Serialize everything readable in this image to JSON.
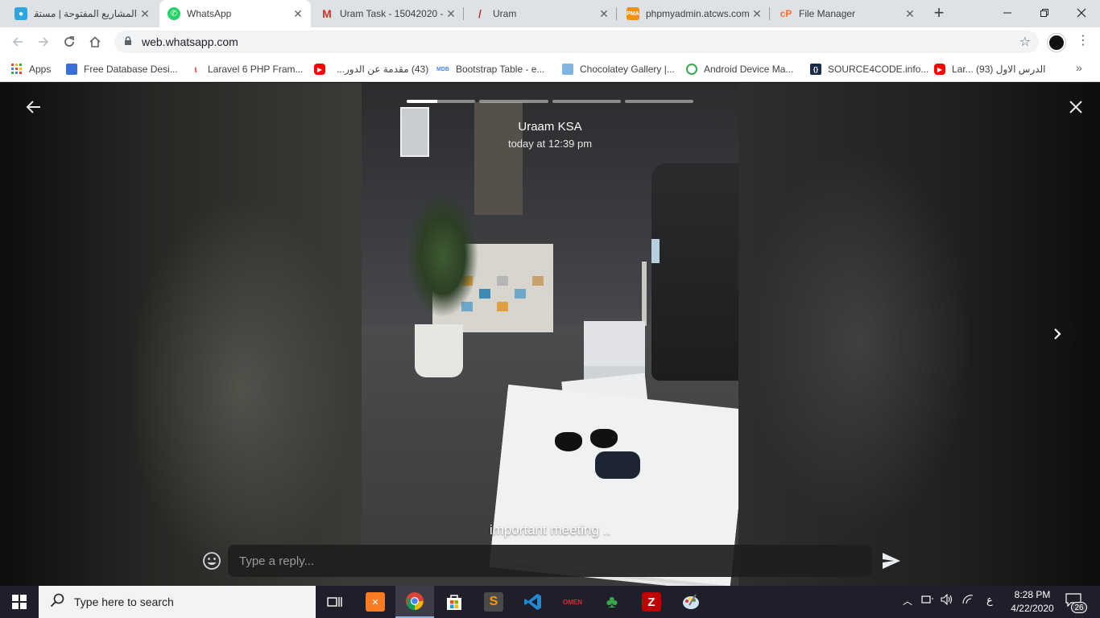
{
  "browser": {
    "tabs": [
      {
        "title": "المشاريع المفتوحة | مستقل",
        "icon": "mostaql-icon",
        "color": "#2ea7e0"
      },
      {
        "title": "WhatsApp",
        "icon": "whatsapp-icon",
        "color": "#25d366",
        "active": true
      },
      {
        "title": "Uram Task - 15042020 -",
        "icon": "gmail-icon",
        "color": "#d93025"
      },
      {
        "title": "Uram",
        "icon": "uram-icon",
        "color": "#c0392b"
      },
      {
        "title": "phpmyadmin.atcws.com",
        "icon": "phpmyadmin-icon",
        "color": "#f29111"
      },
      {
        "title": "File Manager",
        "icon": "cpanel-icon",
        "color": "#ff6c2c"
      }
    ],
    "url": "web.whatsapp.com",
    "bookmarks": [
      {
        "label": "Apps",
        "icon": "apps-grid-icon",
        "color": "#e8453c"
      },
      {
        "label": "Free Database Desi...",
        "icon": "database-icon",
        "color": "#3b6fd8"
      },
      {
        "label": "Laravel 6 PHP Fram...",
        "icon": "laravel-icon",
        "color": "#f05340"
      },
      {
        "label": "(43) مقدمة عن الدور...",
        "icon": "youtube-icon",
        "color": "#ff0000"
      },
      {
        "label": "Bootstrap Table - e...",
        "icon": "mdb-icon",
        "color": "#4285f4"
      },
      {
        "label": "Chocolatey Gallery |...",
        "icon": "chocolatey-icon",
        "color": "#80b5e3"
      },
      {
        "label": "Android Device Ma...",
        "icon": "android-icon",
        "color": "#34a853"
      },
      {
        "label": "SOURCE4CODE.info...",
        "icon": "source4code-icon",
        "color": "#1a2b4a"
      },
      {
        "label": "Lar... الدرس الاول (93)",
        "icon": "youtube-icon",
        "color": "#ff0000"
      }
    ]
  },
  "status": {
    "contact_name": "Uraam KSA",
    "timestamp": "today at 12:39 pm",
    "caption": "important meeting ..",
    "segments": [
      0.45,
      0,
      0,
      0
    ],
    "reply_placeholder": "Type a reply..."
  },
  "taskbar": {
    "search_placeholder": "Type here to search",
    "apps": [
      {
        "name": "task-view-icon",
        "color": "#1f1f2b"
      },
      {
        "name": "xampp-icon",
        "color": "#fb7a24"
      },
      {
        "name": "chrome-icon",
        "color": "#4285f4",
        "active": true
      },
      {
        "name": "store-icon",
        "color": "#0078d7"
      },
      {
        "name": "sublime-text-icon",
        "color": "#ff9800"
      },
      {
        "name": "vscode-icon",
        "color": "#1f8ad2"
      },
      {
        "name": "omen-icon",
        "color": "#d32f2f"
      },
      {
        "name": "clover-icon",
        "color": "#3aa64a"
      },
      {
        "name": "filezilla-icon",
        "color": "#bf0000"
      },
      {
        "name": "paint-icon",
        "color": "#5a9de0"
      }
    ],
    "ime": "ع",
    "time": "8:28 PM",
    "date": "4/22/2020",
    "notifications": "26"
  }
}
